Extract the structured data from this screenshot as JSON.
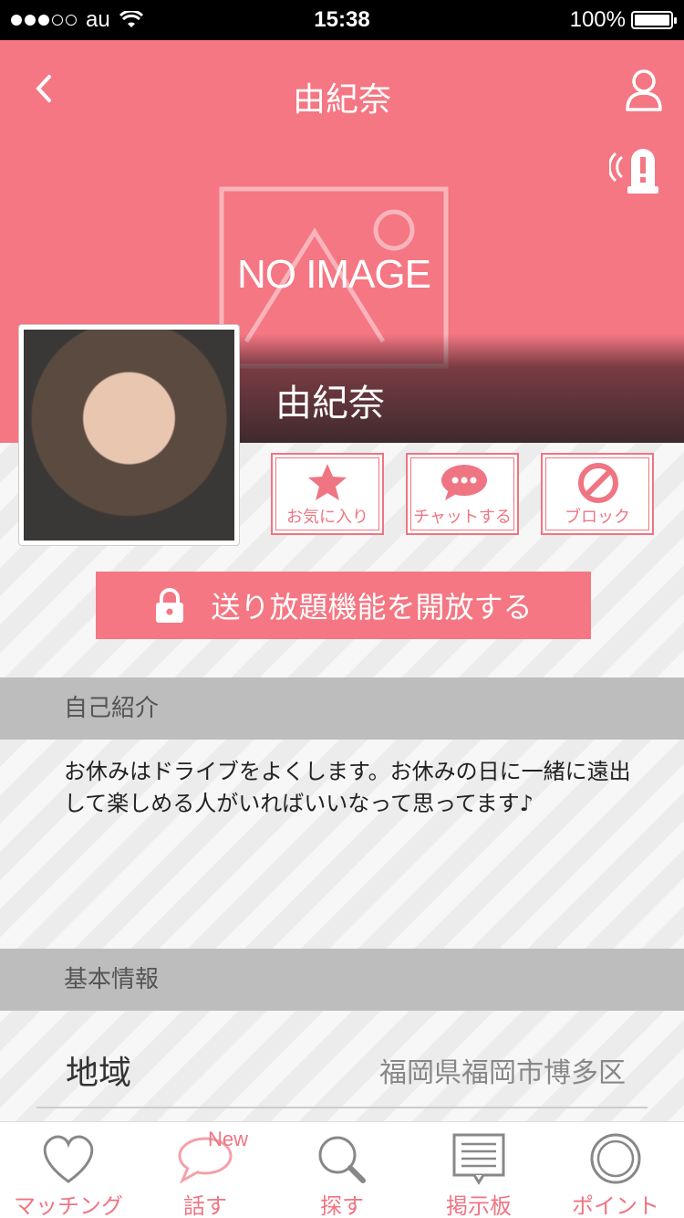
{
  "status_bar": {
    "carrier": "au",
    "time": "15:38",
    "battery": "100%"
  },
  "header": {
    "title": "由紀奈"
  },
  "cover": {
    "placeholder_text": "NO IMAGE",
    "profile_name": "由紀奈"
  },
  "actions": [
    {
      "label": "お気に入り",
      "icon": "star-icon"
    },
    {
      "label": "チャットする",
      "icon": "chat-bubble-icon"
    },
    {
      "label": "ブロック",
      "icon": "block-icon"
    }
  ],
  "unlimited_button": {
    "label": "送り放題機能を開放する",
    "icon": "lock-icon"
  },
  "intro_section": {
    "heading": "自己紹介",
    "text": "お休みはドライブをよくします。お休みの日に一緒に遠出して楽しめる人がいればいいなって思ってます♪"
  },
  "basic_info": {
    "heading": "基本情報",
    "rows": [
      {
        "label": "地域",
        "value": "福岡県福岡市博多区"
      }
    ]
  },
  "tabs": [
    {
      "label": "マッチング",
      "icon": "heart-icon"
    },
    {
      "label": "話す",
      "icon": "speech-bubble-icon",
      "badge": "New"
    },
    {
      "label": "探す",
      "icon": "search-icon"
    },
    {
      "label": "掲示板",
      "icon": "bulletin-board-icon"
    },
    {
      "label": "ポイント",
      "icon": "coin-icon"
    }
  ],
  "colors": {
    "accent": "#f47783",
    "section_bg": "#bdbdbd"
  }
}
